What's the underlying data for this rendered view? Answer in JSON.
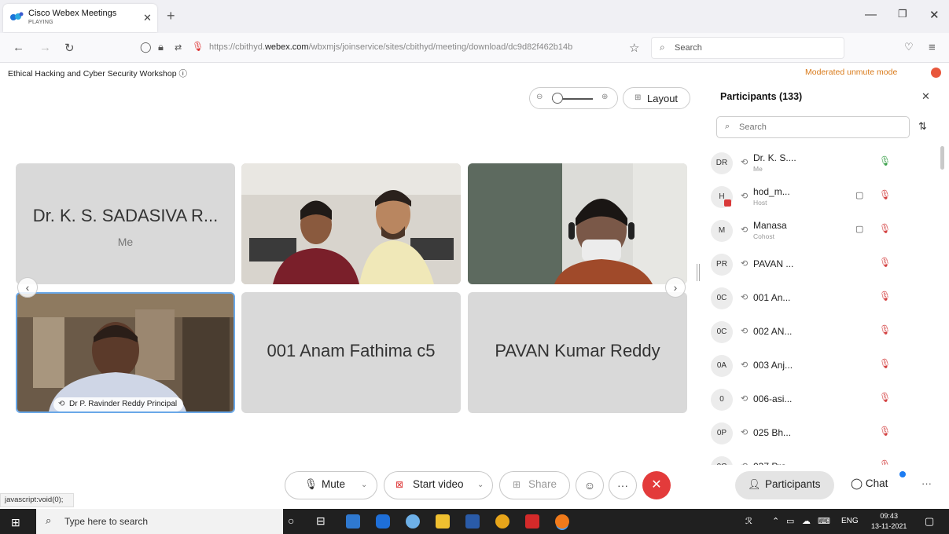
{
  "browser": {
    "tab_title": "Cisco Webex Meetings",
    "tab_subtitle": "PLAYING",
    "url_prefix": "https://cbithyd.",
    "url_domain": "webex.com",
    "url_rest": "/wbxmjs/joinservice/sites/cbithyd/meeting/download/dc9d82f462b14b",
    "search_placeholder": "Search"
  },
  "meeting": {
    "title": "Ethical Hacking and Cyber Security Workshop",
    "unmute_mode": "Moderated unmute mode",
    "layout_label": "Layout"
  },
  "grid": {
    "tile1_name": "Dr. K. S. SADASIVA R...",
    "tile1_sub": "Me",
    "tile4_chip": "Dr P. Ravinder Reddy Principal",
    "tile5_name": "001 Anam Fathima c5",
    "tile6_name": "PAVAN Kumar Reddy"
  },
  "participants": {
    "title": "Participants (133)",
    "search_placeholder": "Search",
    "rows": [
      {
        "initials": "DR",
        "name": "Dr. K. S....",
        "role": "Me",
        "mic_on": true,
        "video": false
      },
      {
        "initials": "H",
        "name": "hod_m...",
        "role": "Host",
        "mic_on": false,
        "video": true
      },
      {
        "initials": "M",
        "name": "Manasa",
        "role": "Cohost",
        "mic_on": false,
        "video": true
      },
      {
        "initials": "PR",
        "name": "PAVAN ...",
        "role": "",
        "mic_on": false,
        "video": false
      },
      {
        "initials": "0C",
        "name": "001 An...",
        "role": "",
        "mic_on": false,
        "video": false
      },
      {
        "initials": "0C",
        "name": "002 AN...",
        "role": "",
        "mic_on": false,
        "video": false
      },
      {
        "initials": "0A",
        "name": "003 Anj...",
        "role": "",
        "mic_on": false,
        "video": false
      },
      {
        "initials": "0",
        "name": "006-asi...",
        "role": "",
        "mic_on": false,
        "video": false
      },
      {
        "initials": "0P",
        "name": "025 Bh...",
        "role": "",
        "mic_on": false,
        "video": false
      },
      {
        "initials": "0C",
        "name": "037 Pra...",
        "role": "",
        "mic_on": false,
        "video": false
      }
    ]
  },
  "controls": {
    "mute": "Mute",
    "start_video": "Start video",
    "share": "Share",
    "participants": "Participants",
    "chat": "Chat"
  },
  "statusbar": "javascript:void(0);",
  "taskbar": {
    "search_placeholder": "Type here to search",
    "lang": "ENG",
    "time": "09:43",
    "date": "13-11-2021"
  },
  "colors": {
    "accent_orange": "#d97a1a",
    "end_red": "#e33b3b",
    "mic_muted": "#d34040",
    "mic_on": "#3aa04a"
  }
}
